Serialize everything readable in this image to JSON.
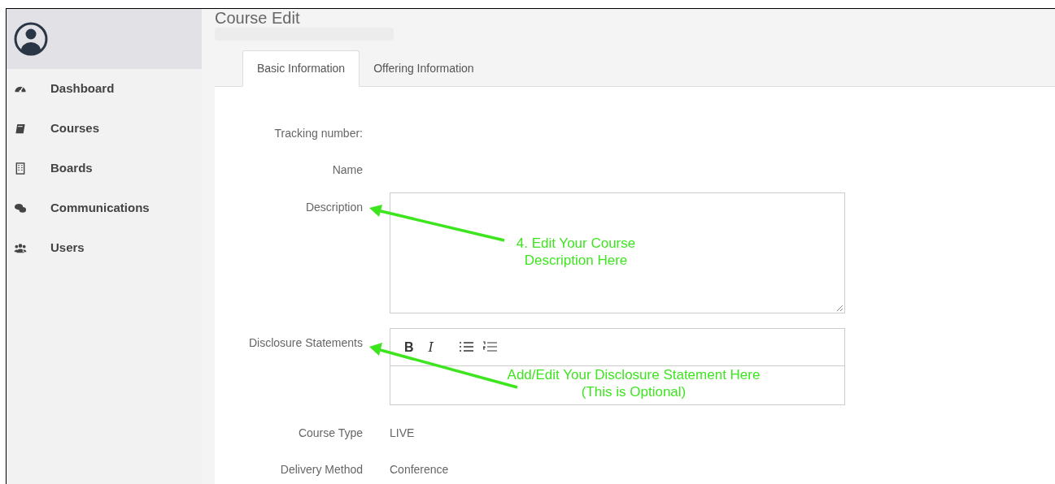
{
  "page_title": "Course Edit",
  "sidebar": {
    "items": [
      {
        "label": "Dashboard",
        "selected": false
      },
      {
        "label": "Courses",
        "selected": false
      },
      {
        "label": "Boards",
        "selected": false
      },
      {
        "label": "Communications",
        "selected": false
      },
      {
        "label": "Users",
        "selected": false
      }
    ]
  },
  "tabs": [
    {
      "label": "Basic Information",
      "selected": true
    },
    {
      "label": "Offering Information",
      "selected": false
    }
  ],
  "fields": [
    {
      "kind": "text",
      "label": "Tracking number:"
    },
    {
      "kind": "text",
      "label": "Name"
    },
    {
      "kind": "textarea",
      "label": "Description"
    },
    {
      "kind": "editor",
      "label": "Disclosure Statements",
      "toolbar": [
        "B",
        "I"
      ]
    },
    {
      "kind": "text",
      "label": "Course Type",
      "value": "LIVE"
    },
    {
      "kind": "text",
      "label": "Delivery Method",
      "value": "Conference"
    }
  ],
  "annotations": [
    "4. Edit Your Course Description Here",
    "Add/Edit Your Disclosure Statement Here (This is Optional)"
  ]
}
